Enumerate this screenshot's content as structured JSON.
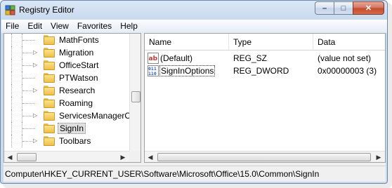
{
  "window": {
    "title": "Registry Editor"
  },
  "caption_buttons": {
    "minimize": "–",
    "maximize": "□",
    "close": "✕"
  },
  "menu": [
    "File",
    "Edit",
    "View",
    "Favorites",
    "Help"
  ],
  "tree": {
    "items": [
      {
        "label": "MathFonts",
        "expander": ""
      },
      {
        "label": "Migration",
        "expander": "▷"
      },
      {
        "label": "OfficeStart",
        "expander": "▷"
      },
      {
        "label": "PTWatson",
        "expander": ""
      },
      {
        "label": "Research",
        "expander": "▷"
      },
      {
        "label": "Roaming",
        "expander": ""
      },
      {
        "label": "ServicesManagerCa",
        "expander": "▷"
      },
      {
        "label": "SignIn",
        "expander": "",
        "selected": true
      },
      {
        "label": "Toolbars",
        "expander": "▷"
      }
    ]
  },
  "list": {
    "columns": [
      "Name",
      "Type",
      "Data"
    ],
    "rows": [
      {
        "name": "(Default)",
        "type": "REG_SZ",
        "data": "(value not set)",
        "icon": "string-value-icon"
      },
      {
        "name": "SignInOptions",
        "type": "REG_DWORD",
        "data": "0x00000003 (3)",
        "icon": "binary-value-icon"
      }
    ]
  },
  "status": {
    "path": "Computer\\HKEY_CURRENT_USER\\Software\\Microsoft\\Office\\15.0\\Common\\SignIn"
  },
  "icons": {
    "app": "registry-editor-icon",
    "folder": "folder-icon",
    "scroll_left": "◀",
    "scroll_right": "▶"
  }
}
